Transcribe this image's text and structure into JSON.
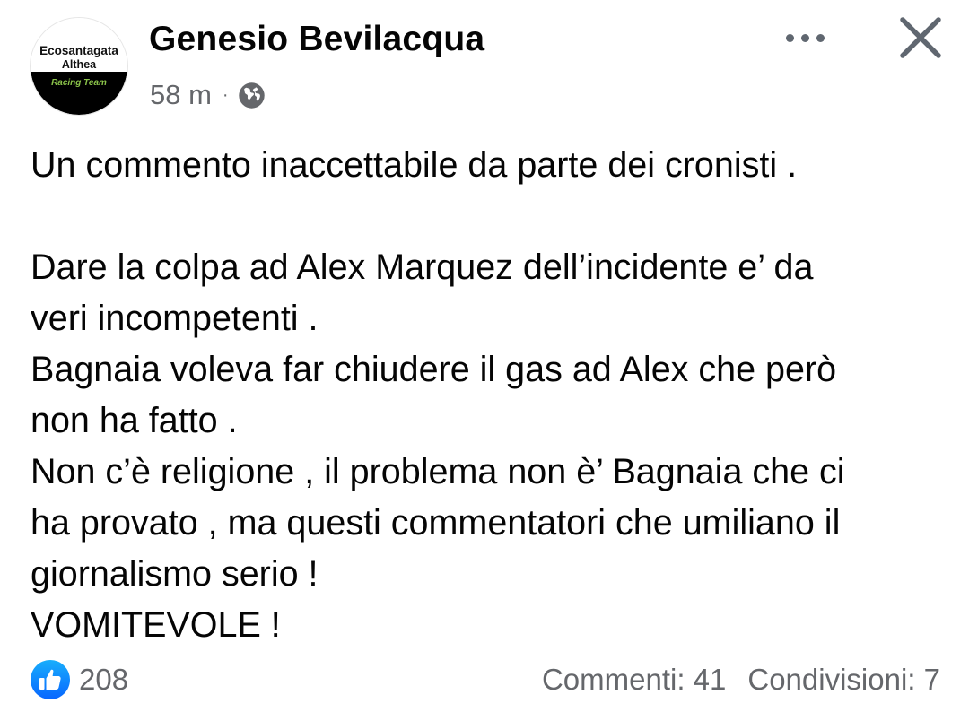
{
  "post": {
    "author": "Genesio Bevilacqua",
    "avatar": {
      "line1": "Ecosantagata",
      "line2": "Althea",
      "line3": "Racing Team"
    },
    "timestamp": "58 m",
    "separator": "·",
    "audience_icon": "globe-icon",
    "more_icon": "more-options-icon",
    "close_icon": "close-icon",
    "body": {
      "line1": "Un commento inaccettabile da parte dei cronisti .",
      "line2": "Dare la colpa ad Alex Marquez dell’incidente  e’ da",
      "line3": "veri incompetenti .",
      "line4": "Bagnaia voleva far chiudere il gas ad Alex che però",
      "line5": "non ha fatto .",
      "line6": "Non c’è religione , il problema non è’ Bagnaia che ci",
      "line7": "ha provato , ma questi commentatori che umiliano il",
      "line8": "giornalismo serio !",
      "line9": "VOMITEVOLE !"
    },
    "footer": {
      "reaction_icon": "like-icon",
      "reaction_count": "208",
      "comments": "Commenti: 41",
      "shares": "Condivisioni: 7"
    },
    "colors": {
      "text": "#050505",
      "secondary": "#65676b",
      "like_blue": "#1877f2",
      "avatar_band": "#000000",
      "avatar_accent": "#8bc34a"
    }
  }
}
